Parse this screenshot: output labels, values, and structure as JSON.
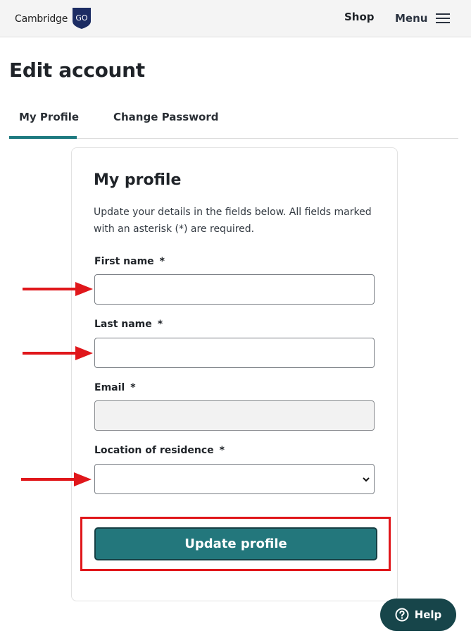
{
  "header": {
    "brand_text": "Cambridge",
    "brand_badge": "GO",
    "shop_label": "Shop",
    "menu_label": "Menu",
    "icons": [
      "shield-logo-icon",
      "hamburger-icon"
    ]
  },
  "page": {
    "title": "Edit account"
  },
  "tabs": [
    {
      "label": "My Profile",
      "active": true
    },
    {
      "label": "Change Password",
      "active": false
    }
  ],
  "profile_form": {
    "title": "My profile",
    "description": "Update your details in the fields below. All fields marked with an asterisk (*) are required.",
    "required_marker": "*",
    "fields": {
      "first_name": {
        "label": "First name",
        "value": ""
      },
      "last_name": {
        "label": "Last name",
        "value": ""
      },
      "email": {
        "label": "Email",
        "value": "",
        "disabled": true
      },
      "location": {
        "label": "Location of residence",
        "selected": ""
      }
    },
    "submit_label": "Update profile"
  },
  "help": {
    "label": "Help",
    "icon": "question-circle-icon"
  },
  "colors": {
    "accent": "#23777c",
    "help_bg": "#17454a",
    "annotation_red": "#e0171b",
    "header_bg": "#f4f4f4"
  }
}
